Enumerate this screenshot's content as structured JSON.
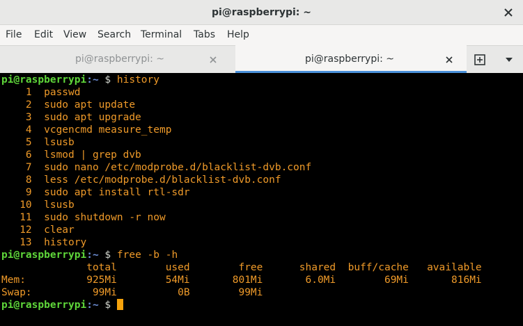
{
  "window": {
    "title": "pi@raspberrypi: ~"
  },
  "menu": [
    "File",
    "Edit",
    "View",
    "Search",
    "Terminal",
    "Tabs",
    "Help"
  ],
  "tabs": [
    {
      "label": "pi@raspberrypi: ~",
      "active": false
    },
    {
      "label": "pi@raspberrypi: ~",
      "active": true
    }
  ],
  "prompt": {
    "user": "pi@raspberrypi",
    "path": ":~",
    "symbol": " $ "
  },
  "commands": {
    "first": "history",
    "second": "free -b -h"
  },
  "history": [
    {
      "num": "    1  ",
      "cmd": "passwd"
    },
    {
      "num": "    2  ",
      "cmd": "sudo apt update"
    },
    {
      "num": "    3  ",
      "cmd": "sudo apt upgrade"
    },
    {
      "num": "    4  ",
      "cmd": "vcgencmd measure_temp"
    },
    {
      "num": "    5  ",
      "cmd": "lsusb"
    },
    {
      "num": "    6  ",
      "cmd": "lsmod | grep dvb"
    },
    {
      "num": "    7  ",
      "cmd": "sudo nano /etc/modprobe.d/blacklist-dvb.conf"
    },
    {
      "num": "    8  ",
      "cmd": "less /etc/modprobe.d/blacklist-dvb.conf"
    },
    {
      "num": "    9  ",
      "cmd": "sudo apt install rtl-sdr"
    },
    {
      "num": "   10  ",
      "cmd": "lsusb"
    },
    {
      "num": "   11  ",
      "cmd": "sudo shutdown -r now"
    },
    {
      "num": "   12  ",
      "cmd": "clear"
    },
    {
      "num": "   13  ",
      "cmd": "history"
    }
  ],
  "free_output": {
    "header": "              total        used        free      shared  buff/cache   available",
    "mem": "Mem:          925Mi        54Mi       801Mi       6.0Mi        69Mi       816Mi",
    "swap": "Swap:          99Mi          0B        99Mi"
  },
  "colors": {
    "user": "#5fd73a",
    "path": "#6e8fd8",
    "output": "#ef9a29",
    "accent": "#4a90d9"
  },
  "icons": {
    "window_close": "close-icon",
    "tab_close": "close-icon",
    "new_tab": "new-tab-icon",
    "menu": "chevron-down-icon"
  }
}
